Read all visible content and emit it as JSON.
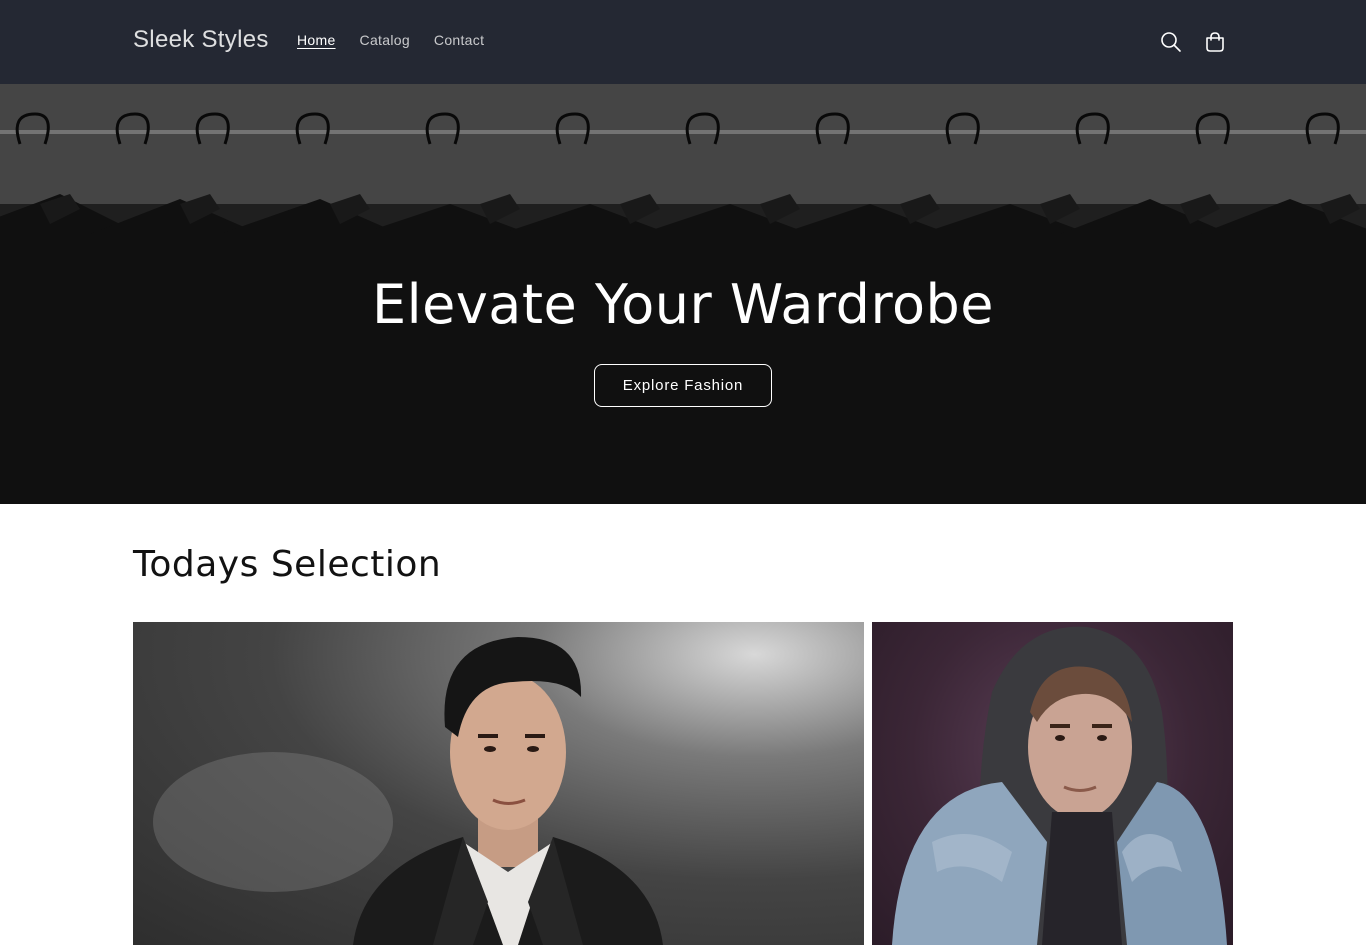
{
  "header": {
    "brand": "Sleek Styles",
    "nav": [
      {
        "label": "Home",
        "active": true
      },
      {
        "label": "Catalog",
        "active": false
      },
      {
        "label": "Contact",
        "active": false
      }
    ],
    "icons": [
      "search-icon",
      "cart-icon"
    ]
  },
  "hero": {
    "title": "Elevate Your Wardrobe",
    "button_label": "Explore Fashion"
  },
  "featured": {
    "title": "Todays Selection"
  },
  "colors": {
    "header_bg": "#242833",
    "text": "#121212",
    "white": "#ffffff"
  }
}
